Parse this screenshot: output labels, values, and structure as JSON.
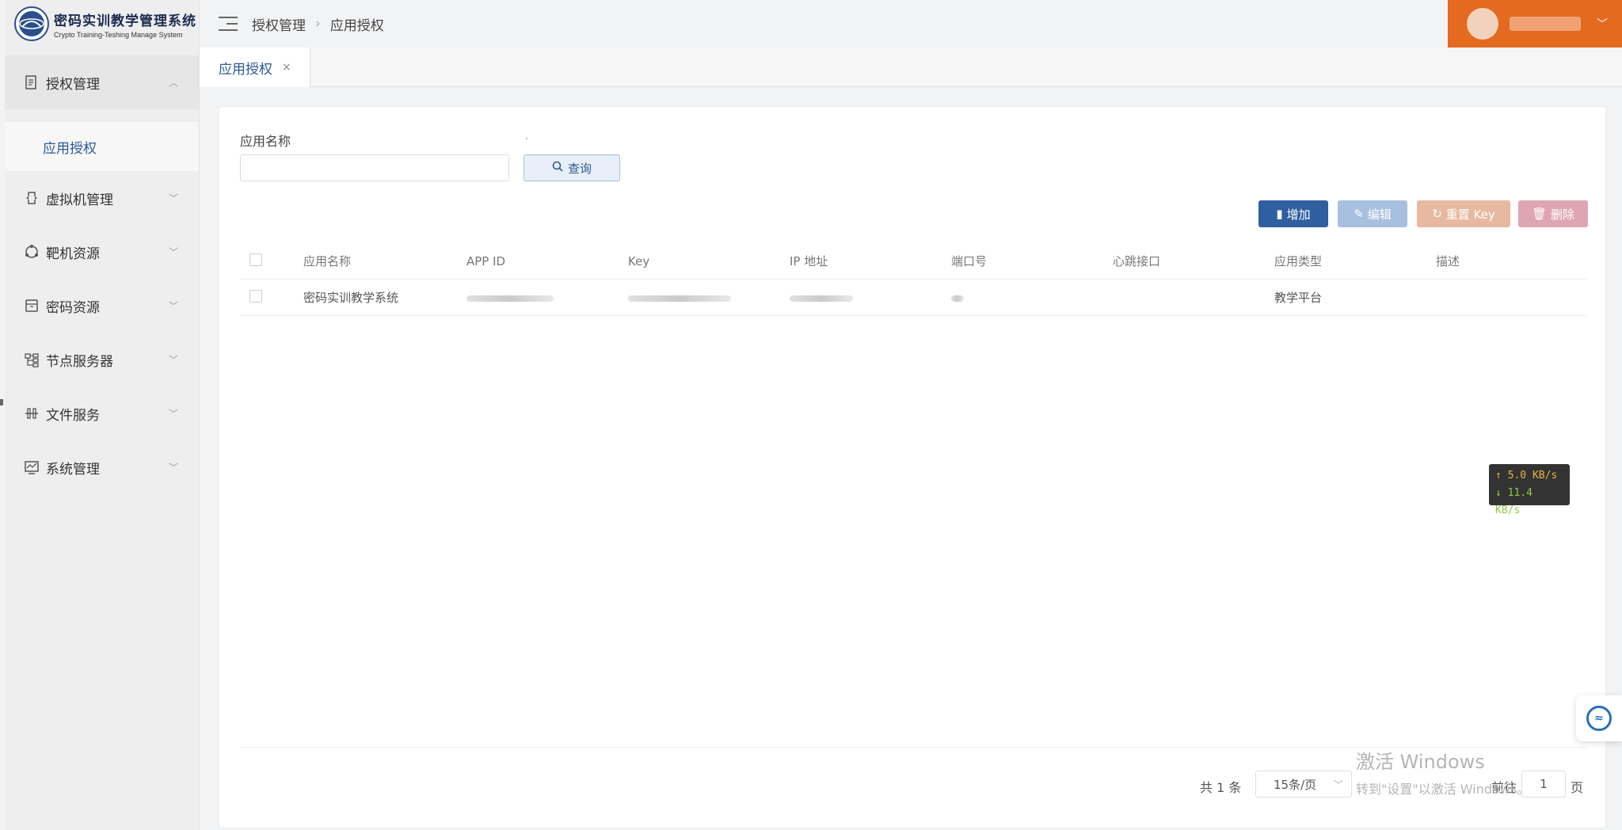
{
  "app": {
    "title": "密码实训教学管理系统",
    "subtitle": "Crypto Training-Teshing Manage System"
  },
  "sidebar": {
    "items": [
      {
        "label": "授权管理",
        "icon": "document-icon",
        "open": true
      },
      {
        "label": "虚拟机管理",
        "icon": "vm-icon"
      },
      {
        "label": "靶机资源",
        "icon": "target-icon"
      },
      {
        "label": "密码资源",
        "icon": "archive-icon"
      },
      {
        "label": "节点服务器",
        "icon": "server-node-icon"
      },
      {
        "label": "文件服务",
        "icon": "file-service-icon"
      },
      {
        "label": "系统管理",
        "icon": "system-icon"
      }
    ],
    "sub_items": [
      {
        "label": "应用授权",
        "active": true
      }
    ]
  },
  "header": {
    "breadcrumb": [
      "授权管理",
      "应用授权"
    ]
  },
  "tabs": [
    {
      "label": "应用授权",
      "close": "×"
    }
  ],
  "search": {
    "label": "应用名称",
    "dot_label": ".",
    "value": "",
    "placeholder": "",
    "query_label": "查询"
  },
  "actions": {
    "add": "增加",
    "edit": "编辑",
    "reset_key": "重置 Key",
    "delete": "删除"
  },
  "table": {
    "columns": [
      "应用名称",
      "APP ID",
      "Key",
      "IP 地址",
      "端口号",
      "心跳接口",
      "应用类型",
      "描述"
    ],
    "rows": [
      {
        "name": "密码实训教学系统",
        "app_id": "",
        "key": "",
        "ip": "",
        "port": "",
        "heartbeat": "",
        "type": "教学平台",
        "desc": ""
      }
    ]
  },
  "pagination": {
    "total": "共 1 条",
    "page_size": "15条/页",
    "goto": "前往",
    "page": "1",
    "suffix": "页"
  },
  "overlay": {
    "upload": "↑ 5.0 KB/s",
    "download": "↓ 11.4 KB/s",
    "watermark_title": "激活 Windows",
    "watermark_sub": "转到\"设置\"以激活 Windows。"
  },
  "colors": {
    "primary": "#2f5f9e",
    "user_bar": "#e36a1f",
    "active_text": "#2c5a96"
  }
}
